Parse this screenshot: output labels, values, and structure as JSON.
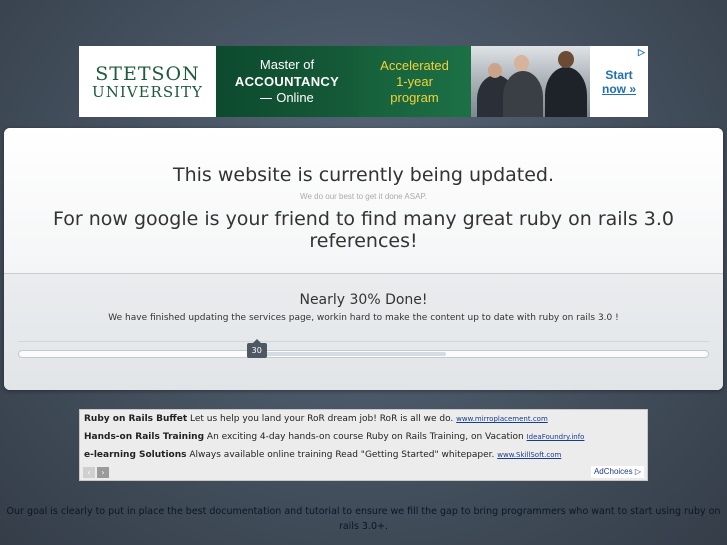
{
  "banner": {
    "logo_line1": "STETSON",
    "logo_line2": "UNIVERSITY",
    "program_line1": "Master of",
    "program_line2": "ACCOUNTANCY",
    "program_line3": "Online",
    "accel_line1": "Accelerated",
    "accel_line2": "1-year",
    "accel_line3": "program",
    "cta_line1": "Start",
    "cta_line2": "now »",
    "ad_arrow": "▷"
  },
  "main": {
    "headline": "This website is currently being updated.",
    "subnote": "We do our best to get it done ASAP.",
    "message": "For now google is your friend to find many great ruby on rails 3.0 references!"
  },
  "progress": {
    "title": "Nearly 30% Done!",
    "description": "We have finished updating the services page, workin hard to make the content up to date with ruby on rails 3.0 !",
    "value": 30,
    "value_label": "30"
  },
  "text_ads": [
    {
      "title": "Ruby on Rails Buffet",
      "text": "Let us help you land your RoR dream job! RoR is all we do.",
      "url": "www.mirroplacement.com"
    },
    {
      "title": "Hands-on Rails Training",
      "text": "An exciting 4-day hands-on course Ruby on Rails Training, on Vacation",
      "url": "IdeaFoundry.info"
    },
    {
      "title": "e-learning Solutions",
      "text": "Always available online training Read \"Getting Started\" whitepaper.",
      "url": "www.SkillSoft.com"
    }
  ],
  "ad_nav": {
    "prev": "‹",
    "next": "›"
  },
  "adchoices": "AdChoices ▷",
  "footer": "Our goal is clearly to put in place the best documentation and tutorial to ensure we fill the gap to bring programmers who want to start using ruby on rails 3.0+."
}
